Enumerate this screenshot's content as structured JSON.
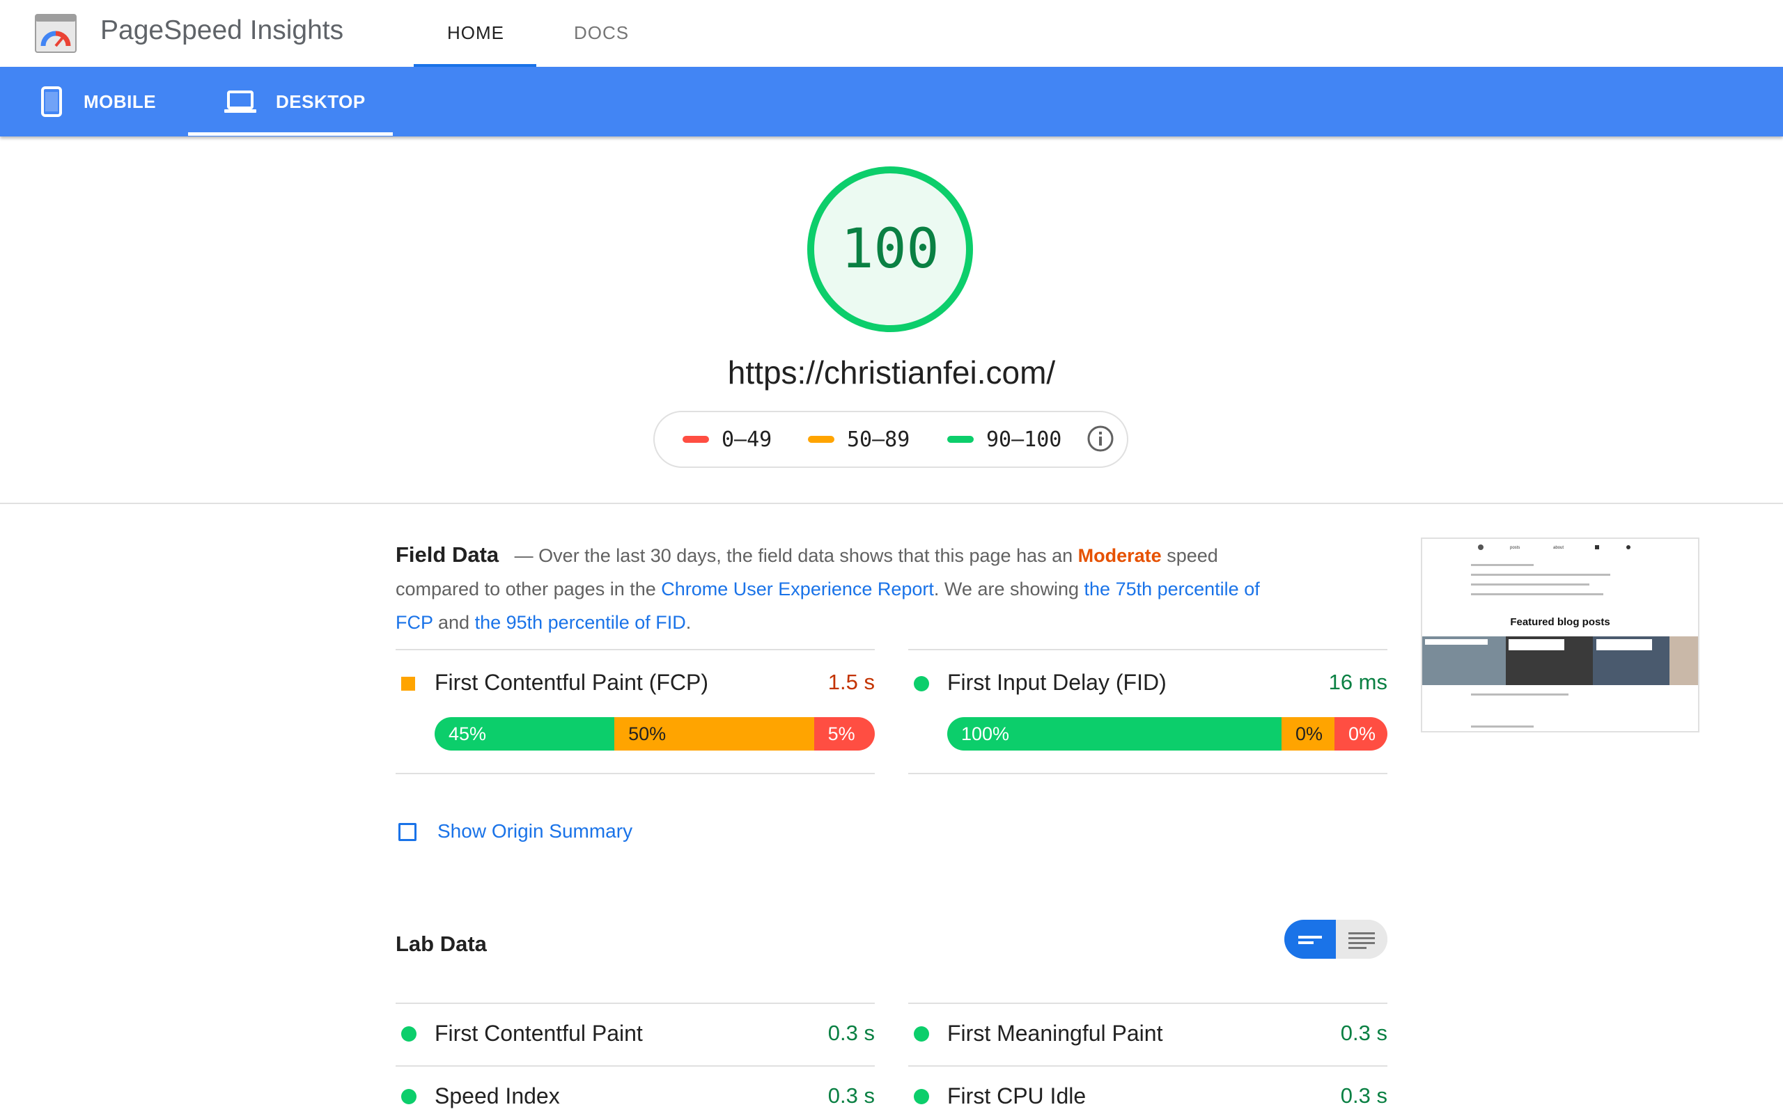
{
  "header": {
    "app_title": "PageSpeed Insights",
    "nav": [
      "HOME",
      "DOCS"
    ],
    "active_nav": "HOME"
  },
  "device_tabs": {
    "mobile": "MOBILE",
    "desktop": "DESKTOP",
    "active": "DESKTOP"
  },
  "score": {
    "value": "100",
    "url": "https://christianfei.com/",
    "legend": [
      "0–49",
      "50–89",
      "90–100"
    ]
  },
  "field_data": {
    "heading": "Field Data",
    "dash": "—",
    "text_1": " Over the last 30 days, the field data shows that this page has an ",
    "speed_word": "Moderate",
    "text_2": " speed compared to other pages in the ",
    "link_crux": "Chrome User Experience Report",
    "text_3": ". We are showing ",
    "link_fcp": "the 75th percentile of FCP",
    "text_4": " and ",
    "link_fid": "the 95th percentile of FID",
    "text_5": ".",
    "metrics": [
      {
        "name": "First Contentful Paint (FCP)",
        "value": "1.5 s",
        "distribution": [
          {
            "label": "45%",
            "pct": 45
          },
          {
            "label": "50%",
            "pct": 50
          },
          {
            "label": "5%",
            "pct": 5
          }
        ]
      },
      {
        "name": "First Input Delay (FID)",
        "value": "16 ms",
        "distribution": [
          {
            "label": "100%",
            "pct": 100
          },
          {
            "label": "0%",
            "pct": 0
          },
          {
            "label": "0%",
            "pct": 0
          }
        ]
      }
    ],
    "origin_summary": "Show Origin Summary"
  },
  "thumbnail": {
    "nav": [
      "posts",
      "about"
    ],
    "featured": "Featured blog posts"
  },
  "lab_data": {
    "heading": "Lab Data",
    "metrics": [
      {
        "name": "First Contentful Paint",
        "value": "0.3 s"
      },
      {
        "name": "First Meaningful Paint",
        "value": "0.3 s"
      },
      {
        "name": "Speed Index",
        "value": "0.3 s"
      },
      {
        "name": "First CPU Idle",
        "value": "0.3 s"
      }
    ]
  },
  "colors": {
    "blue_bar": "#4285f4",
    "good": "#0cce6b",
    "average": "#ffa400",
    "poor": "#ff4e42",
    "link": "#1a73e8"
  }
}
